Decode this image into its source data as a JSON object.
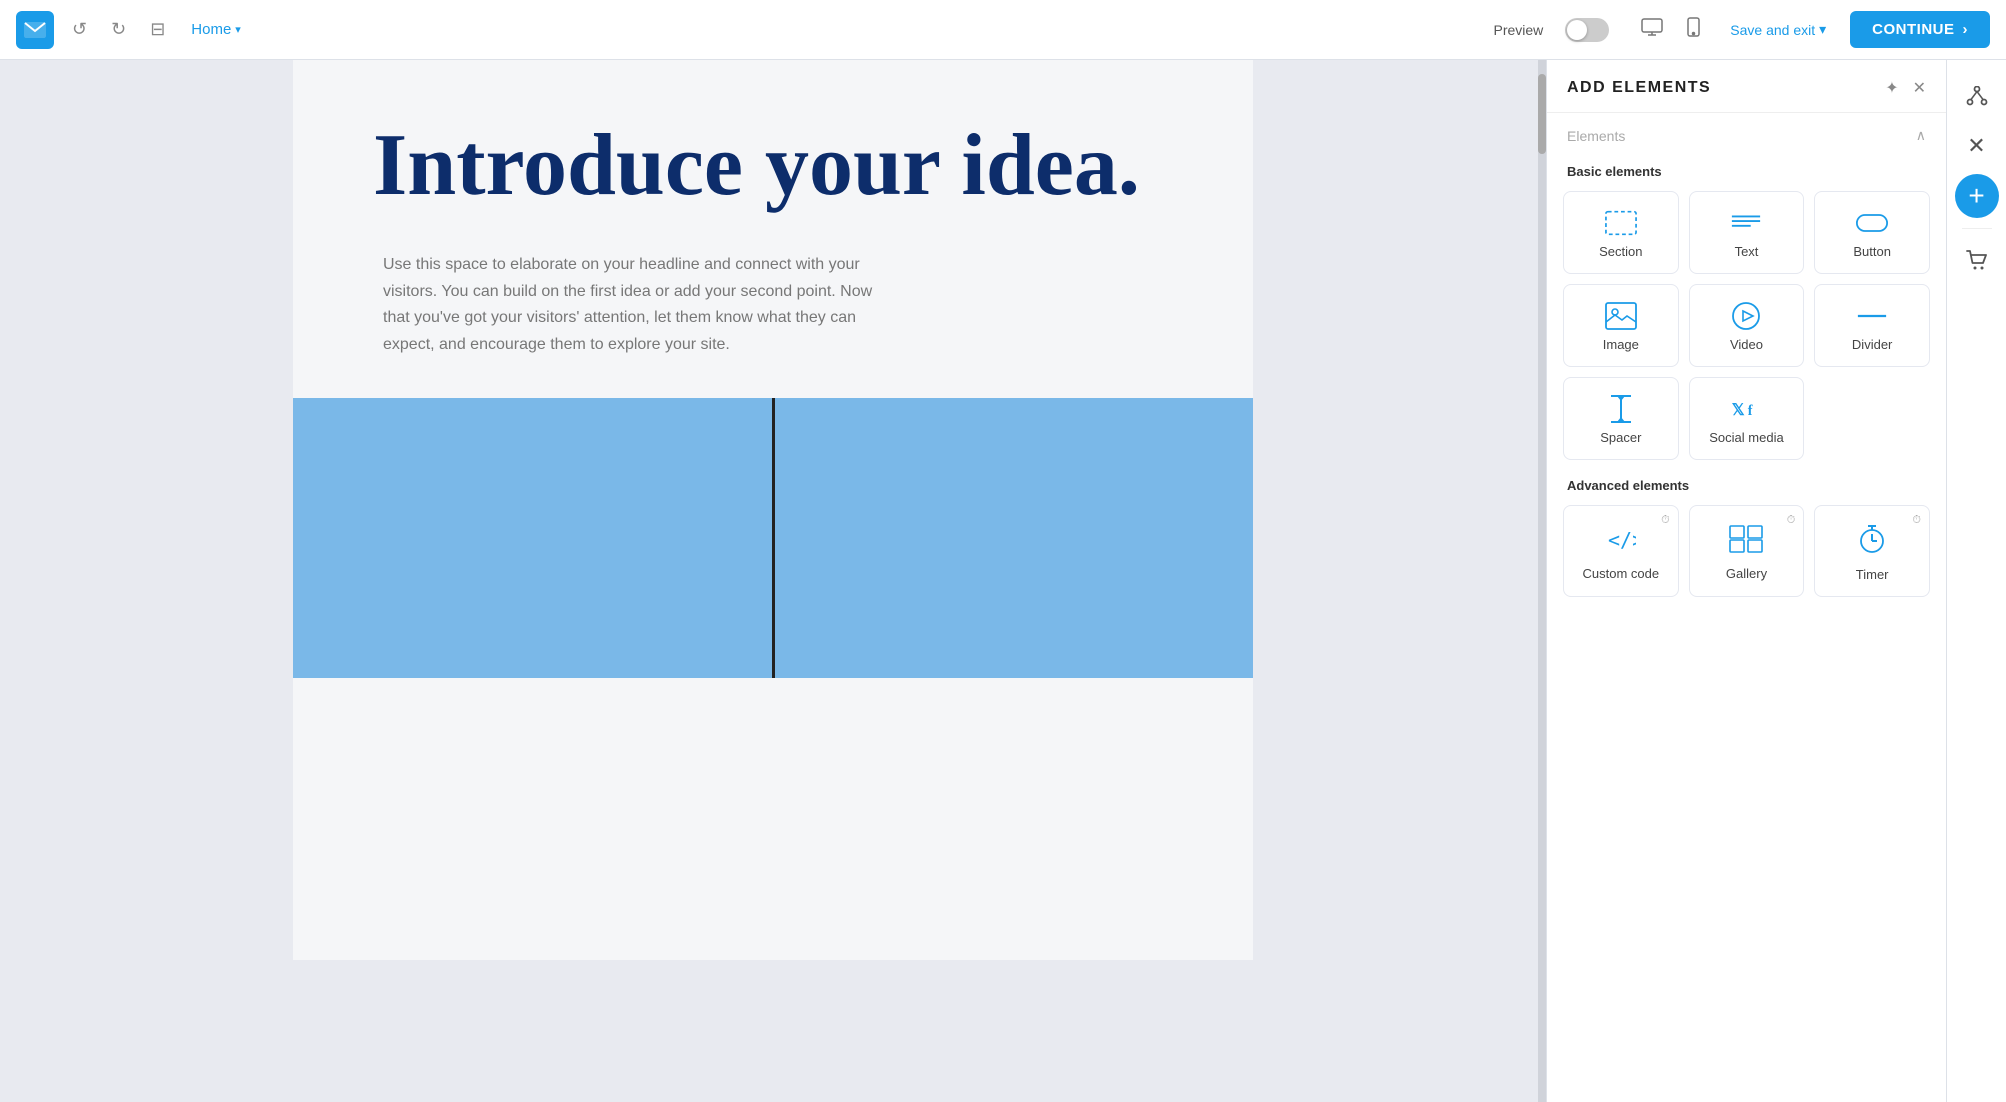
{
  "navbar": {
    "home_label": "Home",
    "preview_label": "Preview",
    "save_exit_label": "Save and exit",
    "continue_label": "CONTINUE",
    "continue_arrow": "→"
  },
  "canvas": {
    "hero_headline": "Introduce your idea.",
    "hero_body": "Use this space to elaborate on your headline and connect with your visitors. You can build on the first idea or add your second point. Now that you've got your visitors' attention, let them know what they can expect, and encourage them to explore your site."
  },
  "panel": {
    "title": "ADD ELEMENTS",
    "elements_group_label": "Elements",
    "basic_label": "Basic elements",
    "advanced_label": "Advanced elements",
    "elements": [
      {
        "id": "section",
        "label": "Section"
      },
      {
        "id": "text",
        "label": "Text"
      },
      {
        "id": "button",
        "label": "Button"
      },
      {
        "id": "image",
        "label": "Image"
      },
      {
        "id": "video",
        "label": "Video"
      },
      {
        "id": "divider",
        "label": "Divider"
      },
      {
        "id": "spacer",
        "label": "Spacer"
      },
      {
        "id": "social-media",
        "label": "Social media"
      }
    ],
    "advanced_elements": [
      {
        "id": "custom-code",
        "label": "Custom code"
      },
      {
        "id": "gallery",
        "label": "Gallery"
      },
      {
        "id": "timer",
        "label": "Timer"
      }
    ]
  },
  "colors": {
    "brand_blue": "#1a9be8",
    "dark_navy": "#0d2d6b",
    "light_bg": "#f5f6f8",
    "blue_section": "#7ab8e8"
  }
}
